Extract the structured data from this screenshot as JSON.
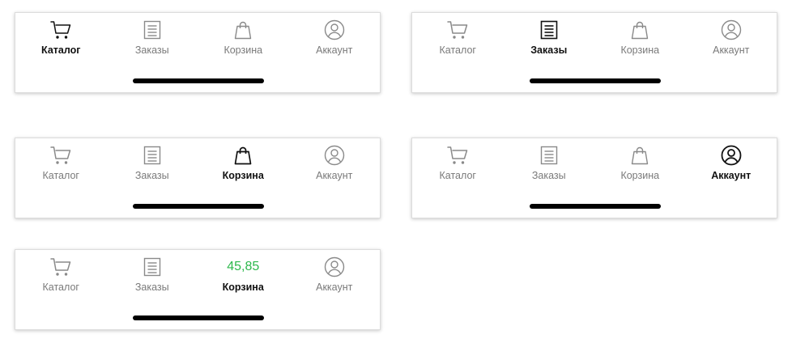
{
  "tabs": {
    "catalog": "Каталог",
    "orders": "Заказы",
    "cart": "Корзина",
    "account": "Аккаунт"
  },
  "cart_total": "45,85",
  "icons": {
    "catalog": "cart-icon",
    "orders": "document-icon",
    "cart": "shopping-bag-icon",
    "account": "user-icon"
  },
  "colors": {
    "active": "#111111",
    "inactive": "#8a8a8a",
    "price": "#2db84c"
  },
  "variants": [
    {
      "selected_tab": "catalog"
    },
    {
      "selected_tab": "orders"
    },
    {
      "selected_tab": "cart"
    },
    {
      "selected_tab": "account"
    },
    {
      "selected_tab": "cart",
      "cart_shows_total": true
    }
  ]
}
